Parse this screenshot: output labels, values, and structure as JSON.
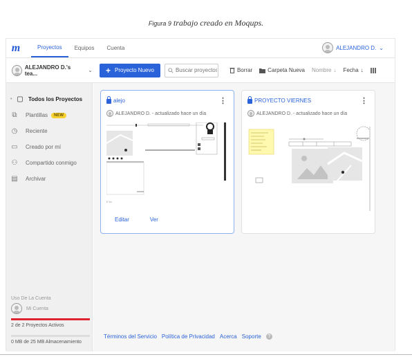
{
  "caption": {
    "figure": "Figura 9",
    "text": "trabajo creado en Moqups."
  },
  "topbar": {
    "logo": "m",
    "tabs": [
      "Proyectos",
      "Equipos",
      "Cuenta"
    ],
    "user": "ALEJANDRO D.",
    "chevron": "⌄"
  },
  "toolbar": {
    "workspace": "ALEJANDRO D.'s tea...",
    "new_project": "Proyecto Nuevo",
    "search_placeholder": "Buscar proyectos",
    "delete": "Borrar",
    "new_folder": "Carpeta Nueva",
    "sort_name": "Nombre",
    "sort_date": "Fecha"
  },
  "sidebar": {
    "items": [
      {
        "label": "Todos los Proyectos",
        "icon": "folder-icon"
      },
      {
        "label": "Plantillas",
        "icon": "templates-icon",
        "badge": "NEW"
      },
      {
        "label": "Reciente",
        "icon": "clock-icon"
      },
      {
        "label": "Creado por mí",
        "icon": "folder-user-icon"
      },
      {
        "label": "Compartido conmigo",
        "icon": "shared-icon"
      },
      {
        "label": "Archivar",
        "icon": "archive-icon"
      }
    ],
    "usage_title": "Uso De La Cuenta",
    "account": "Mi Cuenta",
    "projects_count": "2 de 2 Proyectos Activos",
    "storage": "0 MB de 25 MB Almacenamiento"
  },
  "cards": [
    {
      "title": "alejo",
      "meta": "ALEJANDRO D. - actualizado hace un día",
      "edit": "Editar",
      "view": "Ver"
    },
    {
      "title": "PROYECTO VIERNES",
      "meta": "ALEJANDRO D. - actualizado hace un día"
    }
  ],
  "footer": {
    "links": [
      "Términos del Servicio",
      "Política de Privacidad",
      "Acerca",
      "Soporte"
    ]
  },
  "colors": {
    "accent": "#2a62d9",
    "badge": "#f7d232",
    "usage_bar": "#e0242f"
  }
}
